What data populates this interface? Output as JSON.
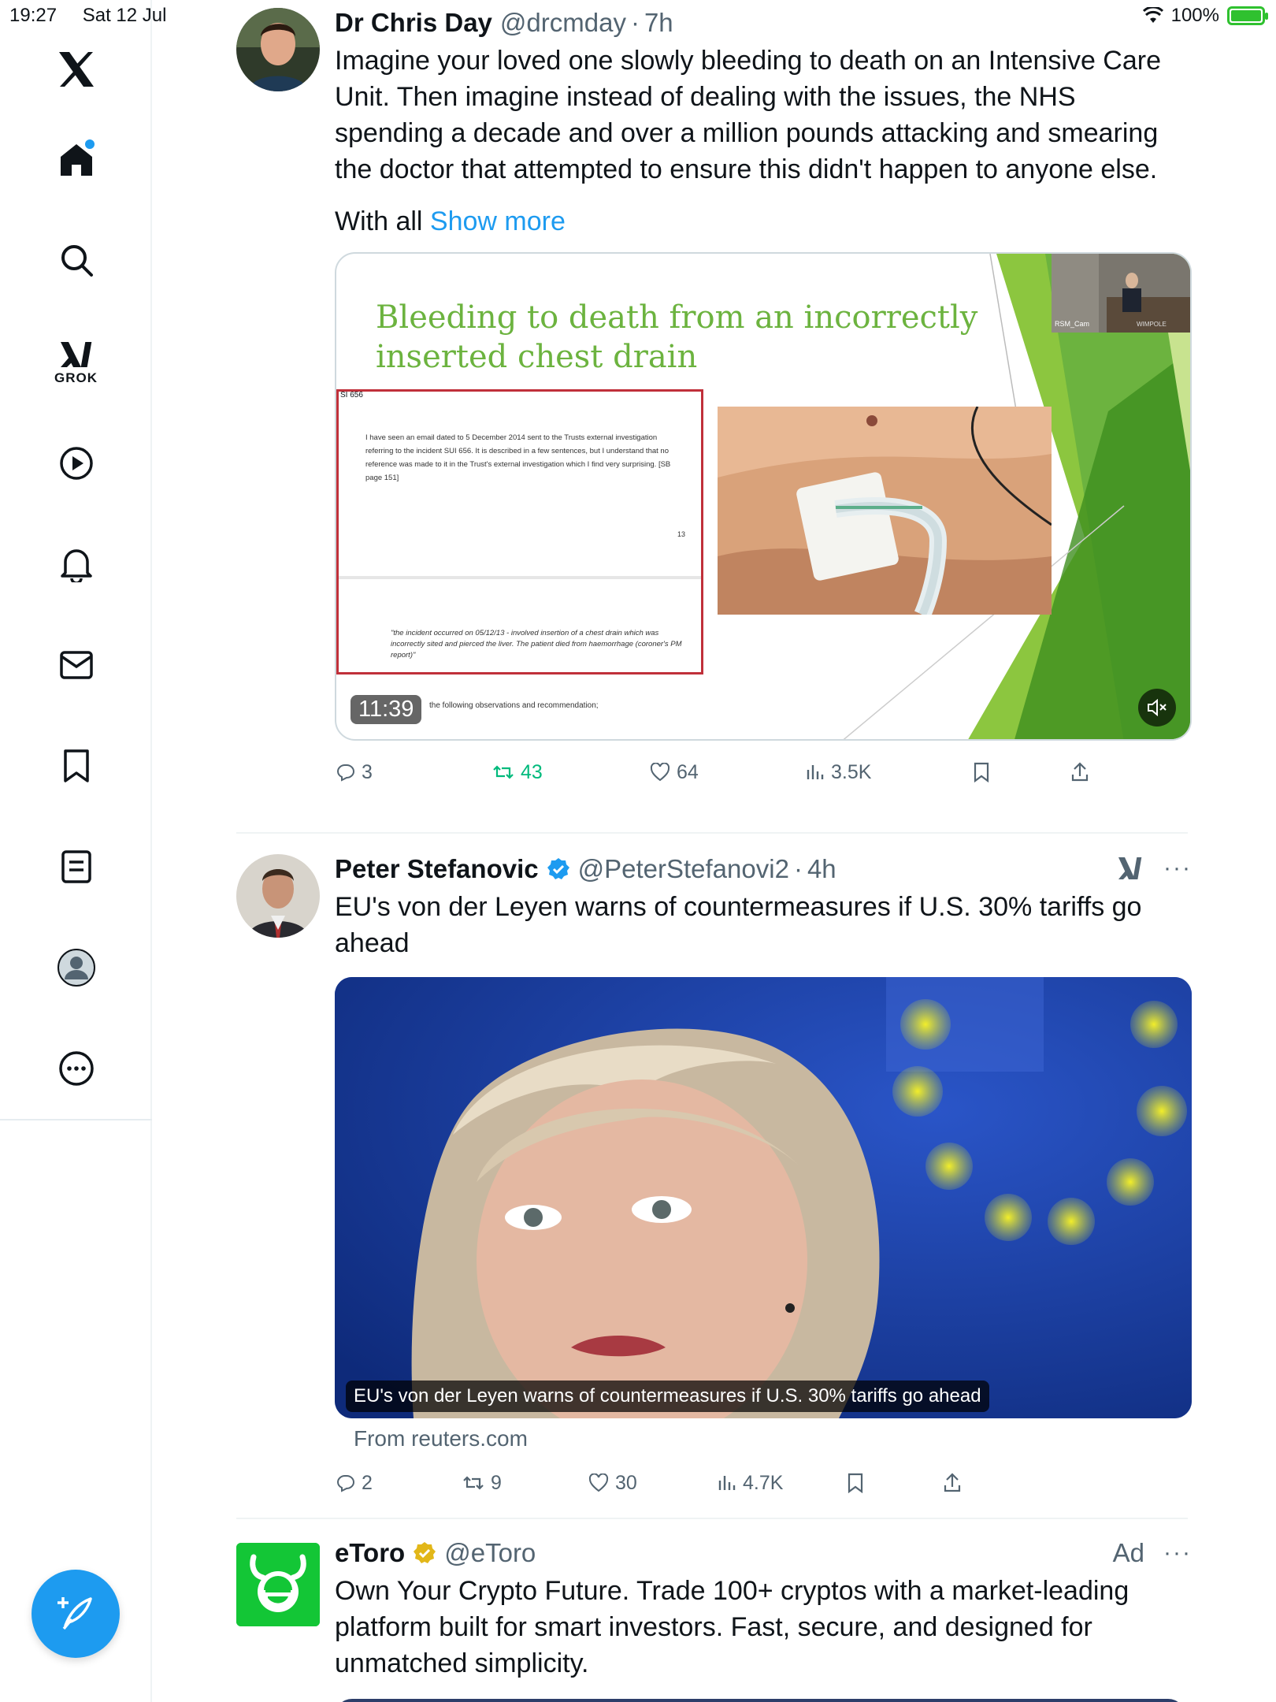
{
  "status_bar": {
    "time": "19:27",
    "date": "Sat 12 Jul",
    "battery": "100%",
    "battery_level": 1.0
  },
  "sidebar": {
    "items": [
      {
        "icon": "x-logo-icon"
      },
      {
        "icon": "home-icon",
        "has_notification_dot": true
      },
      {
        "icon": "search-icon"
      },
      {
        "icon": "grok-icon",
        "label": "GROK"
      },
      {
        "icon": "video-play-icon"
      },
      {
        "icon": "bell-icon"
      },
      {
        "icon": "mail-icon"
      },
      {
        "icon": "bookmark-icon"
      },
      {
        "icon": "lists-icon"
      },
      {
        "icon": "profile-icon"
      },
      {
        "icon": "more-icon"
      }
    ],
    "compose_icon": "compose-icon"
  },
  "tweets": [
    {
      "name": "Dr Chris Day",
      "handle": "@drcmday",
      "time": "7h",
      "text": "Imagine your loved one slowly bleeding to death on an Intensive Care Unit. Then imagine instead of dealing with the issues, the NHS spending a decade and over a million pounds attacking and smearing the doctor that attempted to ensure this didn't happen to anyone else.",
      "text2": "With all",
      "show_more": "Show more",
      "video": {
        "slide_title_line1": "Bleeding to death from an incorrectly",
        "slide_title_line2": "inserted chest drain",
        "doc_label": "SI 656",
        "doc_text": "I have seen an email dated to 5 December 2014 sent to the Trusts external investigation referring to the incident SUI 656. It is described in a few sentences, but I understand that no reference was made to it in the Trust's external investigation which I find very surprising. [SB page 151]",
        "doc_page": "13",
        "doc_quote": "\"the incident occurred on 05/12/13 - involved insertion of a chest drain which was incorrectly sited and pierced the liver. The patient died from haemorrhage (coroner's PM report)\"",
        "doc_footer": "the following observations and recommendation;",
        "pip_label_left": "RSM_Cam",
        "pip_label_right": "WIMPOLE",
        "duration": "11:39",
        "muted": true
      },
      "stats": {
        "replies": "3",
        "reposts": "43",
        "likes": "64",
        "views": "3.5K"
      }
    },
    {
      "name": "Peter Stefanovic",
      "handle": "@PeterStefanovi2",
      "time": "4h",
      "verified": true,
      "text": "EU's von der Leyen warns of countermeasures if U.S. 30% tariffs go ahead",
      "card_caption": "EU's von der Leyen warns of countermeasures if U.S. 30% tariffs go ahead",
      "card_source": "From reuters.com",
      "stats": {
        "replies": "2",
        "reposts": "9",
        "likes": "30",
        "views": "4.7K"
      }
    },
    {
      "name": "eToro",
      "handle": "@eToro",
      "badge": "gold",
      "ad_label": "Ad",
      "text": "Own Your Crypto Future. Trade 100+ cryptos with a market-leading platform built for smart investors. Fast, secure, and designed for unmatched simplicity."
    }
  ],
  "colors": {
    "accent": "#1d9bf0",
    "repost_green": "#00ba7c",
    "etoro_green": "#13c636",
    "slide_green": "#6cb33f"
  }
}
